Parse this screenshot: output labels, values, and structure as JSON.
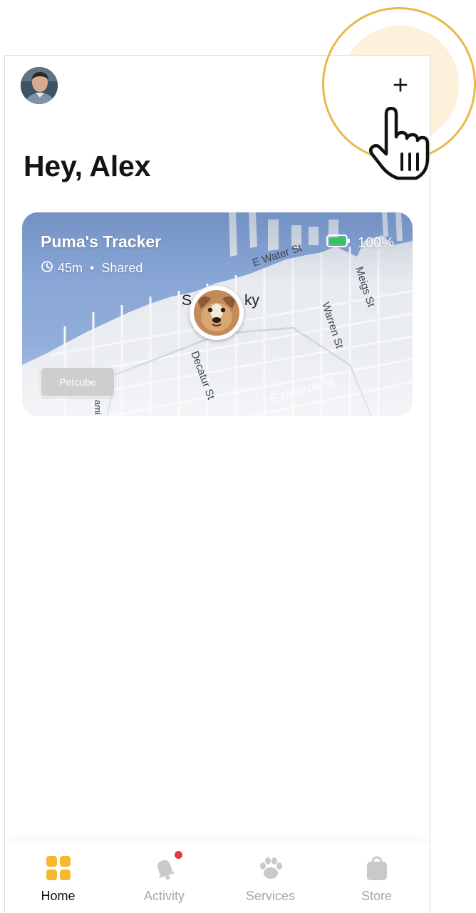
{
  "header": {
    "greeting": "Hey, Alex",
    "add_label": "+"
  },
  "tracker_card": {
    "title": "Puma's Tracker",
    "time_since": "45m",
    "sharing": "Shared",
    "separator": "•",
    "battery_label": "100%",
    "battery_level": 1.0,
    "chip_label": "Petcube",
    "map_labels": {
      "water_st": "E Water St",
      "meigs_st": "Meigs St",
      "warren_st": "Warren St",
      "decatur_st": "Decatur St",
      "monroe_st": "E Monroe St",
      "place_left": "S",
      "place_right": "ky",
      "side_street": "ami"
    }
  },
  "tabbar": {
    "items": [
      {
        "label": "Home",
        "icon": "home-grid-icon",
        "active": true
      },
      {
        "label": "Activity",
        "icon": "bell-icon",
        "active": false,
        "has_badge": true
      },
      {
        "label": "Services",
        "icon": "paw-icon",
        "active": false
      },
      {
        "label": "Store",
        "icon": "bag-icon",
        "active": false
      }
    ]
  },
  "colors": {
    "accent": "#f5b82e",
    "highlight_ring": "#e9b84a",
    "highlight_fill": "#fdf1dc",
    "water": "#7f9fd3",
    "land": "#e6e9ee",
    "battery": "#34c759",
    "badge": "#e23b3b"
  }
}
